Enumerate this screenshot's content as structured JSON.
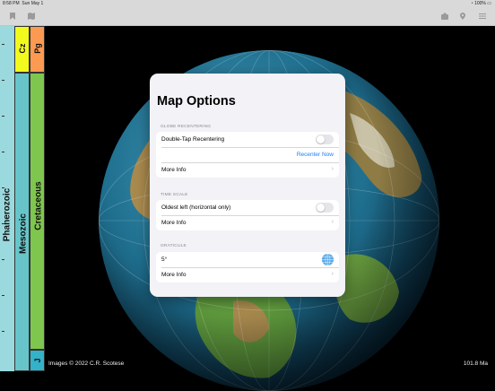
{
  "status": {
    "time": "8:58 PM",
    "date": "Sun May 1",
    "battery": "100%"
  },
  "navbar": {
    "icons": [
      "bookmark-icon",
      "map-icon",
      "camera-icon",
      "location-pin-icon",
      "list-icon"
    ]
  },
  "timescale": {
    "eon": "Phanerozoic",
    "era": "Mesozoic",
    "era_upper": "Cz",
    "period": "Cretaceous",
    "period_upper": "Pg",
    "period_lower": "J",
    "colors": {
      "eon": "#9ad9dd",
      "era": "#67c5ca",
      "cenozoic": "#f2f91d",
      "cretaceous": "#7fc64e",
      "paleogene": "#fd9a52",
      "jurassic": "#34b2c9"
    }
  },
  "footer": {
    "credit": "Images © 2022 C.R. Scotese",
    "age": "101.8 Ma"
  },
  "panel": {
    "title": "Map Options",
    "globe_recentering": {
      "header": "GLOBE RECENTERING",
      "double_tap_label": "Double-Tap Recentering",
      "double_tap_on": false,
      "recenter_label": "Recenter Now",
      "more_info": "More Info"
    },
    "time_scale": {
      "header": "TIME SCALE",
      "oldest_left_label": "Oldest left (horizontal only)",
      "oldest_left_on": false,
      "more_info": "More Info"
    },
    "graticule": {
      "header": "GRATICULE",
      "value": "5°",
      "more_info": "More Info"
    },
    "accent": "#1a7ff5"
  }
}
